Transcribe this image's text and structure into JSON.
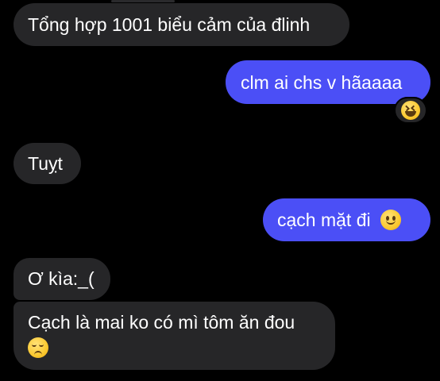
{
  "colors": {
    "background": "#000000",
    "incoming_bubble": "#262628",
    "outgoing_bubble": "#4b4ff6",
    "text": "#ffffff"
  },
  "messages": [
    {
      "direction": "incoming",
      "text": "Tổng hợp 1001 biểu cảm của đlinh"
    },
    {
      "direction": "outgoing",
      "text": "clm ai chs v hãaaaa",
      "reaction": "grinning-squinting-face-icon"
    },
    {
      "direction": "incoming",
      "text": "Tuỵt"
    },
    {
      "direction": "outgoing",
      "text": "cạch mặt đi",
      "emoji": "slightly-smiling-face-icon"
    },
    {
      "direction": "incoming",
      "text": "Ơ kìa:_("
    },
    {
      "direction": "incoming",
      "text": "Cạch là mai ko có mì tôm ăn đou",
      "emoji": "disappointed-face-icon"
    }
  ]
}
